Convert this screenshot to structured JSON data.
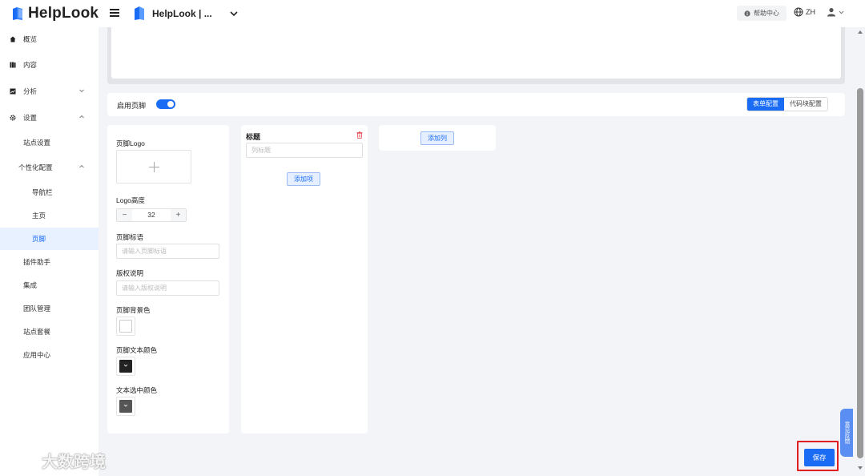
{
  "header": {
    "brand": "HelpLook",
    "site_name": "HelpLook | ...",
    "help_center": "帮助中心",
    "language": "ZH"
  },
  "sidebar": {
    "items": [
      {
        "label": "概览",
        "icon": "home-icon"
      },
      {
        "label": "内容",
        "icon": "book-icon"
      },
      {
        "label": "分析",
        "icon": "chart-icon"
      },
      {
        "label": "设置",
        "icon": "gear-icon"
      },
      {
        "label": "站点设置"
      },
      {
        "label": "个性化配置"
      },
      {
        "label": "导航栏"
      },
      {
        "label": "主页"
      },
      {
        "label": "页脚"
      },
      {
        "label": "插件助手"
      },
      {
        "label": "集成"
      },
      {
        "label": "团队管理"
      },
      {
        "label": "站点套餐"
      },
      {
        "label": "应用中心"
      }
    ]
  },
  "footer_switch": {
    "label": "启用页脚",
    "enabled": true
  },
  "config_tabs": {
    "form": "表单配置",
    "code": "代码块配置",
    "active": "表单配置"
  },
  "form": {
    "logo_label": "页脚Logo",
    "logo_height_label": "Logo高度",
    "logo_height_value": "32",
    "slogan_label": "页脚标语",
    "slogan_placeholder": "请输入页脚标语",
    "copyright_label": "版权说明",
    "copyright_placeholder": "请输入版权说明",
    "bg_color_label": "页脚背景色",
    "text_color_label": "页脚文本颜色",
    "selected_color_label": "文本选中颜色",
    "bg_color": "#ffffff",
    "text_color": "#222222",
    "selected_color": "#555555"
  },
  "column": {
    "title": "标题",
    "placeholder": "列标题",
    "add_item": "添加项"
  },
  "add_column": "添加列",
  "save": "保存",
  "feedback": "意见反馈",
  "watermark": "大数跨境",
  "colors": {
    "accent": "#1a6cf5",
    "highlight": "#e02020"
  }
}
